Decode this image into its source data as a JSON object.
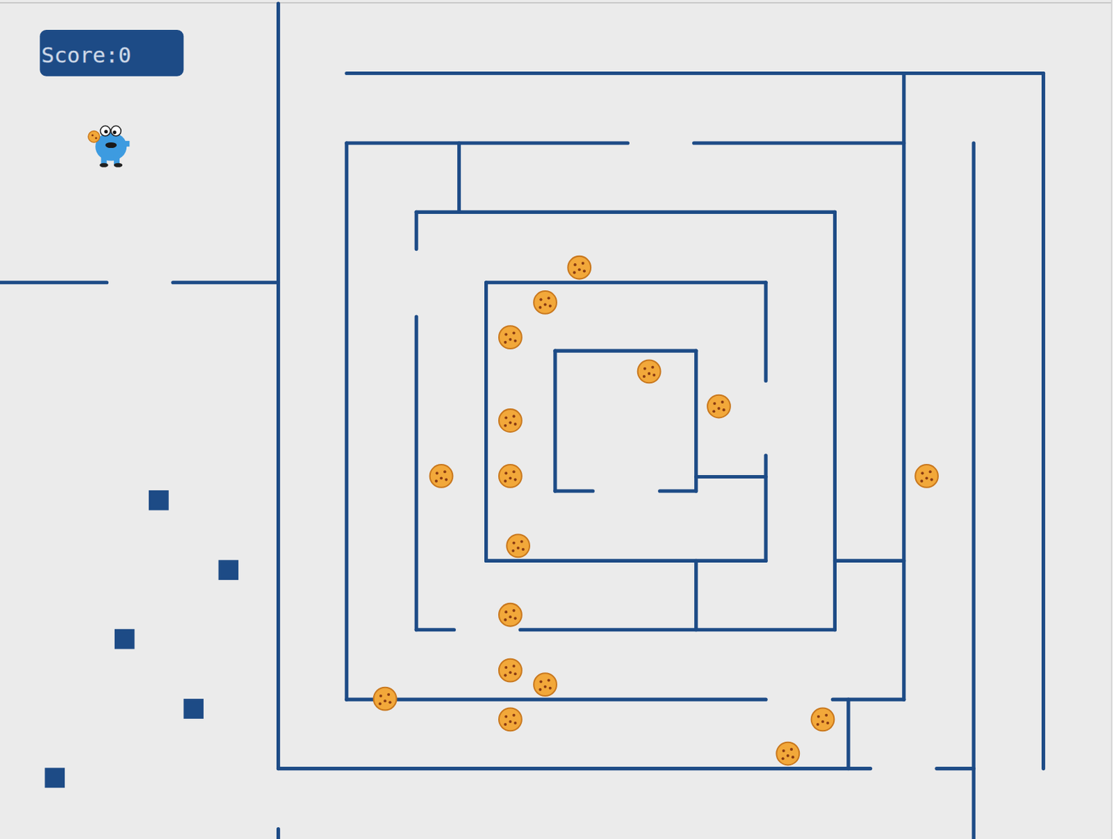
{
  "score": {
    "label": "Score:0"
  }
}
